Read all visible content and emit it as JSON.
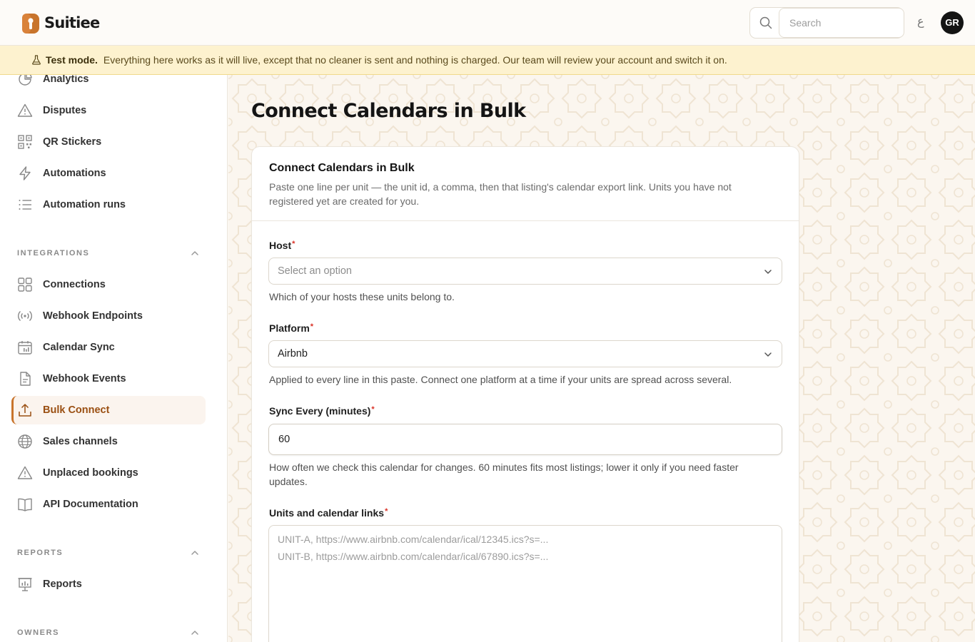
{
  "app": {
    "name": "Suitiee"
  },
  "topbar": {
    "search_placeholder": "Search",
    "lang_glyph": "ع",
    "avatar_initials": "GR"
  },
  "banner": {
    "label": "Test mode.",
    "text": "Everything here works as it will live, except that no cleaner is sent and nothing is charged. Our team will review your account and switch it on."
  },
  "sidebar": {
    "items_top": [
      {
        "label": "Analytics",
        "icon": "analytics-icon"
      },
      {
        "label": "Disputes",
        "icon": "warning-icon"
      },
      {
        "label": "QR Stickers",
        "icon": "qr-code-icon"
      },
      {
        "label": "Automations",
        "icon": "lightning-icon"
      },
      {
        "label": "Automation runs",
        "icon": "list-icon"
      }
    ],
    "sections": {
      "integrations": "INTEGRATIONS",
      "reports": "REPORTS",
      "owners": "OWNERS"
    },
    "integrations": [
      {
        "label": "Connections",
        "icon": "grid-icon"
      },
      {
        "label": "Webhook Endpoints",
        "icon": "broadcast-icon"
      },
      {
        "label": "Calendar Sync",
        "icon": "calendar-icon"
      },
      {
        "label": "Webhook Events",
        "icon": "document-icon"
      },
      {
        "label": "Bulk Connect",
        "icon": "upload-icon",
        "active": true
      },
      {
        "label": "Sales channels",
        "icon": "globe-icon"
      },
      {
        "label": "Unplaced bookings",
        "icon": "warning-icon"
      },
      {
        "label": "API Documentation",
        "icon": "book-icon"
      }
    ],
    "reports": [
      {
        "label": "Reports",
        "icon": "presentation-chart-icon"
      }
    ]
  },
  "main": {
    "title": "Connect Calendars in Bulk",
    "card": {
      "title": "Connect Calendars in Bulk",
      "description": "Paste one line per unit — the unit id, a comma, then that listing's calendar export link. Units you have not registered yet are created for you.",
      "host": {
        "label": "Host",
        "required": "*",
        "placeholder": "Select an option",
        "help": "Which of your hosts these units belong to."
      },
      "platform": {
        "label": "Platform",
        "required": "*",
        "value": "Airbnb",
        "help": "Applied to every line in this paste. Connect one platform at a time if your units are spread across several."
      },
      "sync": {
        "label": "Sync Every (minutes)",
        "required": "*",
        "value": "60",
        "help": "How often we check this calendar for changes. 60 minutes fits most listings; lower it only if you need faster updates."
      },
      "units": {
        "label": "Units and calendar links",
        "required": "*",
        "placeholder": "UNIT-A, https://www.airbnb.com/calendar/ical/12345.ics?s=...\nUNIT-B, https://www.airbnb.com/calendar/ical/67890.ics?s=..."
      }
    }
  },
  "colors": {
    "accent": "#c8742c",
    "active_text": "#9a4f12",
    "banner_bg": "#fdf2cf",
    "required": "#d93025"
  }
}
